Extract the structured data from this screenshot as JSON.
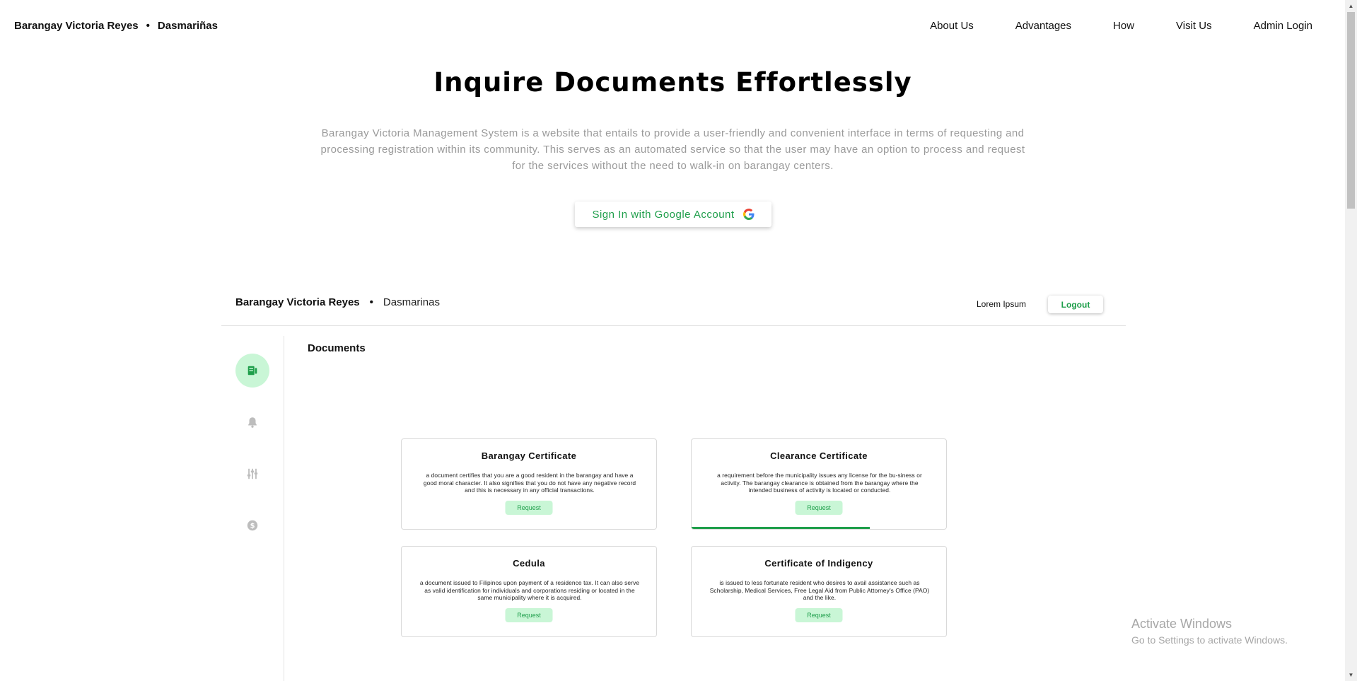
{
  "nav": {
    "brand_name": "Barangay Victoria Reyes",
    "brand_separator": "•",
    "brand_location": "Dasmariñas",
    "links": [
      "About Us",
      "Advantages",
      "How",
      "Visit Us",
      "Admin Login"
    ]
  },
  "hero": {
    "title": "Inquire Documents Effortlessly",
    "description": "Barangay Victoria Management System is a website that entails to provide a user-friendly and convenient interface in terms of requesting and processing registration within its community. This serves as an automated service so that the user may have an option to process and request for the services without the need to walk-in on barangay centers.",
    "google_button_label": "Sign In with Google Account"
  },
  "preview": {
    "brand_name": "Barangay Victoria Reyes",
    "brand_separator": "•",
    "brand_location": "Dasmarinas",
    "user_name": "Lorem Ipsum",
    "logout_label": "Logout",
    "section_title": "Documents",
    "sidebar_icons": [
      "document-icon",
      "bell-icon",
      "sliders-icon",
      "dollar-icon"
    ],
    "cards": [
      {
        "title": "Barangay  Certificate",
        "description": "a document certifies that you are a good resident in the barangay and have a good moral character. It also signifies that you do not have any negative record and this is necessary in any official transactions.",
        "button": "Request"
      },
      {
        "title": "Clearance  Certificate",
        "description": "a requirement before the municipality issues any license for the bu-siness or activity. The barangay clearance is obtained from the barangay where the intended business of activity is located or conducted.",
        "button": "Request",
        "progress": 0.7
      },
      {
        "title": "Cedula",
        "description": "a document issued to Filipinos upon payment of a residence tax. It can also serve as valid identification for individuals and corporations residing or located in the same municipality where it is acquired.",
        "button": "Request"
      },
      {
        "title": "Certificate of Indigency",
        "description": "is issued to less fortunate resident who desires to avail assistance such as Scholarship, Medical Services, Free Legal Aid from Public Attorney's Office (PAO) and the like.",
        "button": "Request"
      }
    ]
  },
  "watermark": {
    "line1": "Activate Windows",
    "line2": "Go to Settings to activate Windows."
  },
  "colors": {
    "accent_green": "#1e9e4a",
    "light_green": "#c9f6d6",
    "muted_text": "#9a9a9a"
  }
}
